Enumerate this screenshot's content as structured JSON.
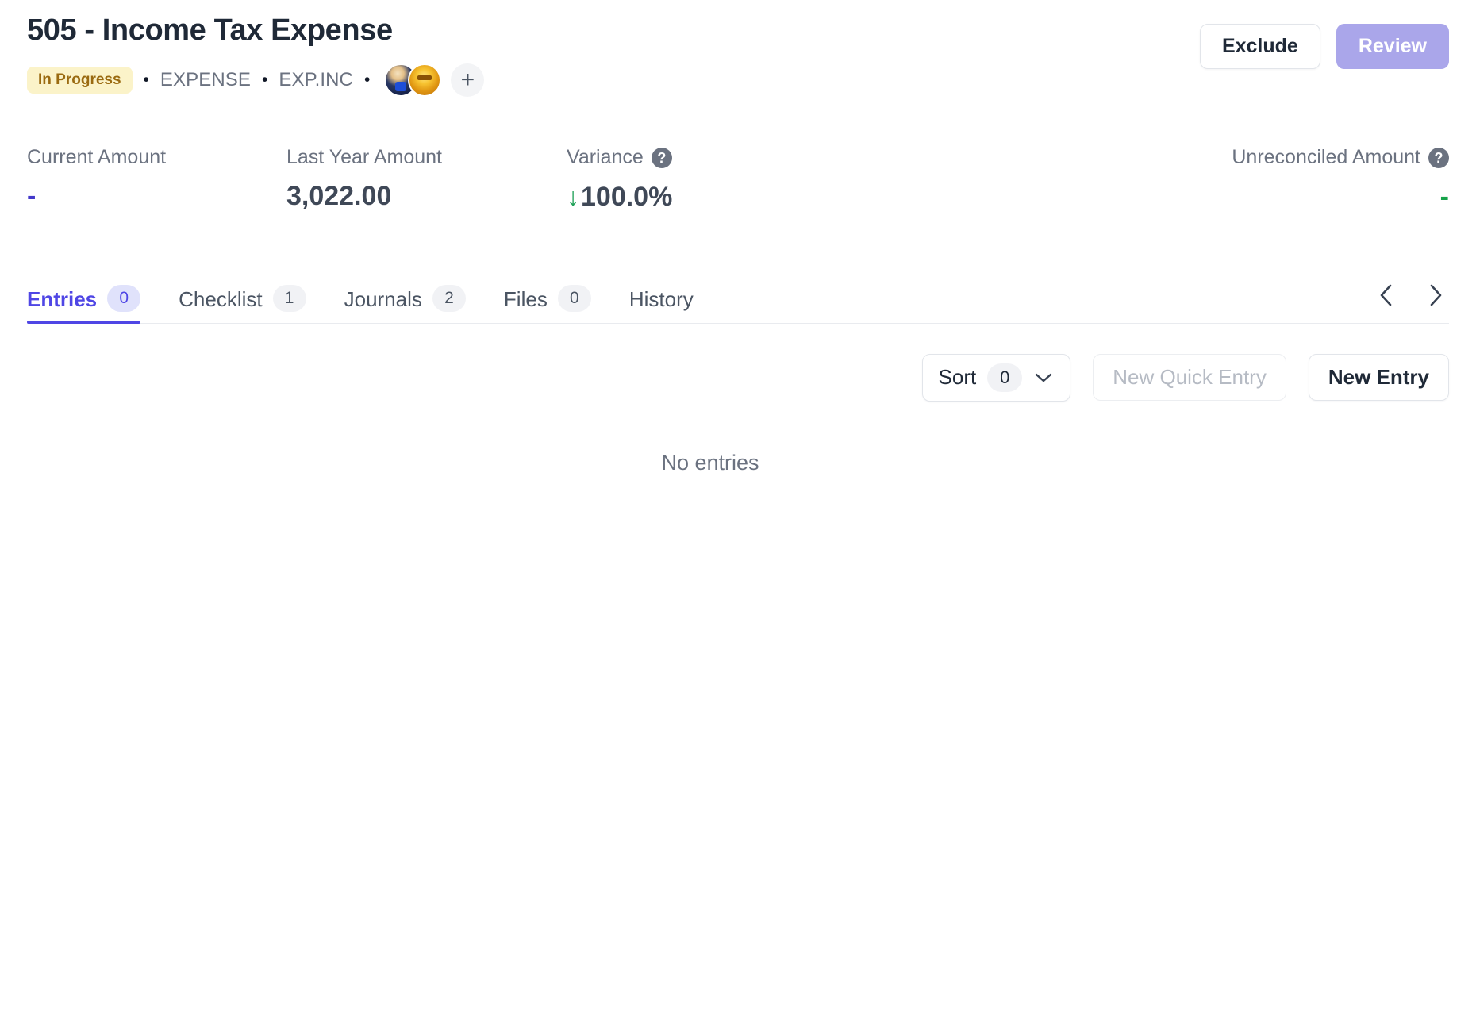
{
  "header": {
    "title": "505 - Income Tax Expense",
    "status_badge": "In Progress",
    "breadcrumbs": [
      "EXPENSE",
      "EXP.INC"
    ],
    "separator": "•",
    "add_person_glyph": "+",
    "exclude_label": "Exclude",
    "review_label": "Review",
    "accent_review_bg": "#aaa6ea",
    "badge_bg": "#fbf3c9",
    "badge_fg": "#9a6a10"
  },
  "metrics": {
    "current": {
      "label": "Current Amount",
      "value": "-"
    },
    "last_year": {
      "label": "Last Year Amount",
      "value": "3,022.00"
    },
    "variance": {
      "label": "Variance",
      "help": "?",
      "arrow": "↓",
      "value": "100.0%",
      "arrow_color": "#22a25a"
    },
    "unreconciled": {
      "label": "Unreconciled Amount",
      "help": "?",
      "value": "-"
    }
  },
  "tabs": [
    {
      "label": "Entries",
      "count": "0",
      "active": true
    },
    {
      "label": "Checklist",
      "count": "1",
      "active": false
    },
    {
      "label": "Journals",
      "count": "2",
      "active": false
    },
    {
      "label": "Files",
      "count": "0",
      "active": false
    },
    {
      "label": "History",
      "count": "",
      "active": false
    }
  ],
  "tab_nav": {
    "prev_icon": "chevron-left-icon",
    "next_icon": "chevron-right-icon"
  },
  "toolbar": {
    "sort_label": "Sort",
    "sort_count": "0",
    "sort_chevron": "chevron-down-icon",
    "new_quick_entry_label": "New Quick Entry",
    "new_entry_label": "New Entry"
  },
  "content": {
    "empty_message": "No entries"
  },
  "colors": {
    "accent_indigo": "#4f46e5",
    "review_purple": "#aaa6ea",
    "green": "#22a25a",
    "text_dark": "#1f2937",
    "text_muted": "#6b7280"
  }
}
